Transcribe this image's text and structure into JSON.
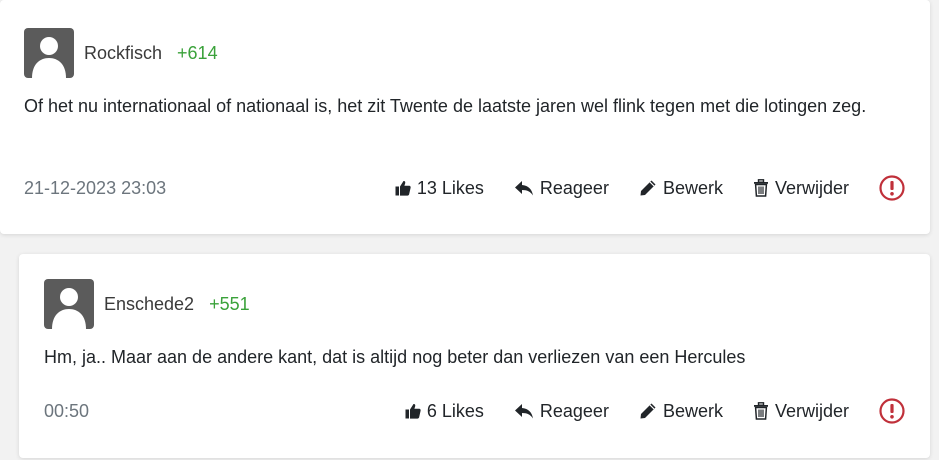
{
  "comments": [
    {
      "username": "Rockfisch",
      "karma": "+614",
      "text": "Of het nu internationaal of nationaal is, het zit Twente de laatste jaren wel flink tegen met die lotingen zeg.",
      "timestamp": "21-12-2023 23:03",
      "likes_label": "13 Likes",
      "reply_label": "Reageer",
      "edit_label": "Bewerk",
      "delete_label": "Verwijder"
    },
    {
      "username": "Enschede2",
      "karma": "+551",
      "text": "Hm, ja.. Maar aan de andere kant, dat is altijd nog beter dan verliezen van een Hercules",
      "timestamp": "00:50",
      "likes_label": "6 Likes",
      "reply_label": "Reageer",
      "edit_label": "Bewerk",
      "delete_label": "Verwijder"
    }
  ],
  "colors": {
    "karma": "#3aa23a",
    "report": "#c0303a",
    "avatar_bg": "#5b5b5b"
  },
  "icons": {
    "like": "thumbs-up-icon",
    "reply": "reply-arrow-icon",
    "edit": "pencil-icon",
    "delete": "trash-icon",
    "report": "report-exclamation-icon",
    "avatar": "user-silhouette-icon"
  }
}
